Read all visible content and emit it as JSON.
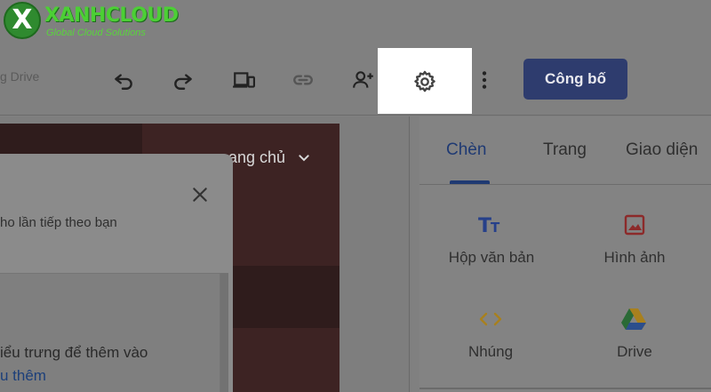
{
  "logo": {
    "name": "XANHCLOUD",
    "tagline": "Global Cloud Solutions",
    "letter": "X"
  },
  "toolbar": {
    "drive_label": "g Drive",
    "icons": [
      "undo-icon",
      "redo-icon",
      "device-preview-icon",
      "link-icon",
      "share-add-person-icon",
      "gear-icon",
      "more-vert-icon"
    ],
    "publish_label": "Công bố"
  },
  "canvas": {
    "hero_nav_text": "ang chủ"
  },
  "popup": {
    "text_line1": "ho lần tiếp theo bạn",
    "text_line2": "iểu trưng để thêm vào",
    "link_text": "u thêm"
  },
  "panel": {
    "tabs": [
      {
        "label": "Chèn",
        "active": true
      },
      {
        "label": "Trang",
        "active": false
      },
      {
        "label": "Giao diện",
        "active": false
      }
    ],
    "tiles": [
      {
        "label": "Hộp văn bản",
        "icon": "text-box-icon"
      },
      {
        "label": "Hình ảnh",
        "icon": "image-icon"
      },
      {
        "label": "Nhúng",
        "icon": "embed-code-icon"
      },
      {
        "label": "Drive",
        "icon": "google-drive-icon"
      }
    ]
  },
  "colors": {
    "accent": "#2e3c6e",
    "tab_active": "#1f3a73",
    "logo_green": "#4ccf35",
    "icon_blue": "#26408a",
    "icon_red": "#8c2a2a",
    "icon_orange": "#a8801e"
  }
}
